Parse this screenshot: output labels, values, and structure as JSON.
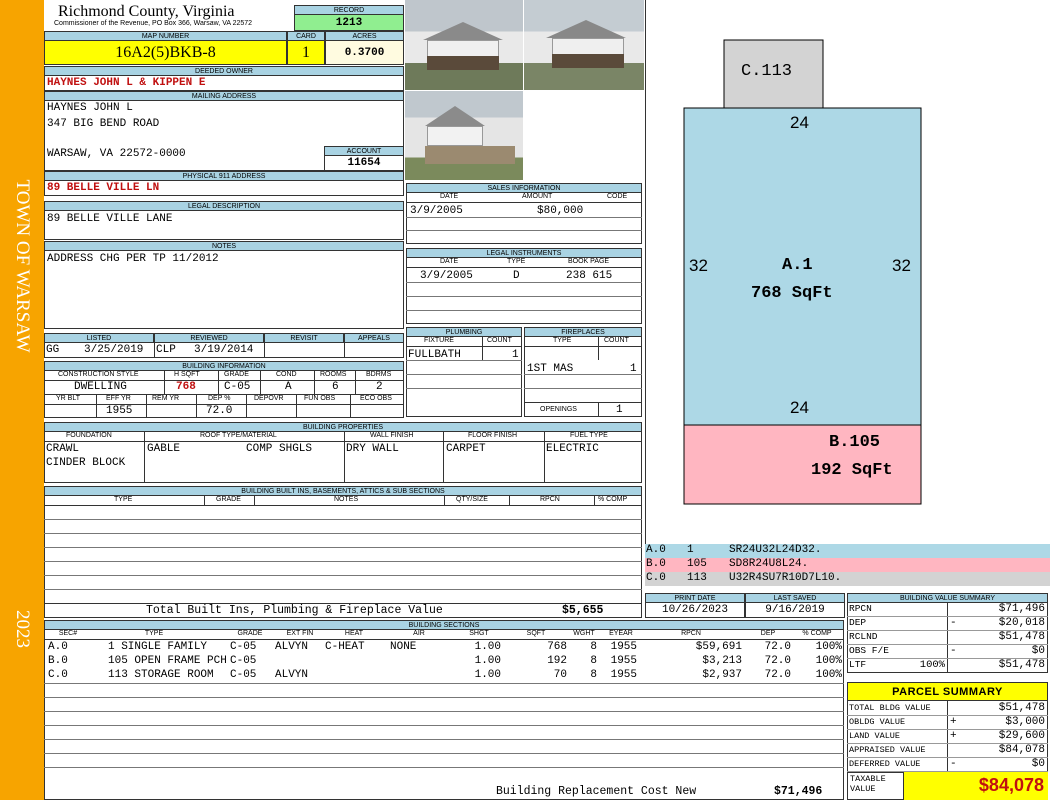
{
  "sidebar": {
    "town": "TOWN OF WARSAW",
    "year": "2023"
  },
  "header": {
    "county": "Richmond County, Virginia",
    "commissioner": "Commissioner of the Revenue, PO Box 366, Warsaw, VA 22572",
    "record_label": "RECORD",
    "record": "1213",
    "map_number_label": "MAP NUMBER",
    "map_number": "16A2(5)BKB-8",
    "card_label": "CARD",
    "card": "1",
    "acres_label": "ACRES",
    "acres": "0.3700"
  },
  "owner": {
    "deeded_owner_label": "DEEDED OWNER",
    "deeded_owner": "HAYNES JOHN L & KIPPEN E",
    "mailing_label": "MAILING ADDRESS",
    "mailing_line1": "HAYNES JOHN L",
    "mailing_line2": "347 BIG BEND ROAD",
    "mailing_line3": "WARSAW, VA 22572-0000",
    "account_label": "ACCOUNT",
    "account": "11654",
    "physical_label": "PHYSICAL 911 ADDRESS",
    "physical": "89 BELLE VILLE LN",
    "legal_label": "LEGAL DESCRIPTION",
    "legal": "89 BELLE VILLE LANE",
    "notes_label": "NOTES",
    "notes": "ADDRESS CHG PER TP 11/2012"
  },
  "listing": {
    "listed_label": "LISTED",
    "listed_by": "GG",
    "listed_date": "3/25/2019",
    "reviewed_label": "REVIEWED",
    "reviewed_by": "CLP",
    "reviewed_date": "3/19/2014",
    "revisit_label": "REVISIT",
    "appeals_label": "APPEALS"
  },
  "building_info": {
    "title": "BUILDING INFORMATION",
    "headers": [
      "CONSTRUCTION STYLE",
      "H SQFT",
      "GRADE",
      "COND",
      "ROOMS",
      "BDRMS"
    ],
    "values": [
      "DWELLING",
      "768",
      "C-05",
      "A",
      "6",
      "2"
    ],
    "headers2": [
      "YR BLT",
      "EFF YR",
      "REM YR",
      "DEP %",
      "DEPOVR",
      "FUN OBS",
      "ECO OBS"
    ],
    "values2": [
      "",
      "1955",
      "",
      "72.0",
      "",
      "",
      ""
    ]
  },
  "sales": {
    "title": "SALES INFORMATION",
    "headers": [
      "DATE",
      "AMOUNT",
      "CODE"
    ],
    "rows": [
      [
        "3/9/2005",
        "$80,000",
        ""
      ]
    ]
  },
  "legal_instruments": {
    "title": "LEGAL INSTRUMENTS",
    "headers": [
      "DATE",
      "TYPE",
      "BOOK PAGE"
    ],
    "rows": [
      [
        "3/9/2005",
        "D",
        "238 615"
      ]
    ]
  },
  "plumbing": {
    "title": "PLUMBING",
    "headers": [
      "FIXTURE",
      "COUNT"
    ],
    "rows": [
      [
        "FULLBATH",
        "1"
      ]
    ]
  },
  "fireplaces": {
    "title": "FIREPLACES",
    "headers": [
      "TYPE",
      "COUNT"
    ],
    "rows": [
      [
        "1ST MAS",
        "1"
      ]
    ],
    "openings_label": "OPENINGS",
    "openings": "1"
  },
  "building_properties": {
    "title": "BUILDING PROPERTIES",
    "headers": [
      "FOUNDATION",
      "ROOF TYPE/MATERIAL",
      "WALL FINISH",
      "FLOOR FINISH",
      "FUEL TYPE"
    ],
    "foundation": [
      "CRAWL",
      "CINDER BLOCK"
    ],
    "roof_type": "GABLE",
    "roof_material": "COMP SHGLS",
    "wall": "DRY WALL",
    "floor": "CARPET",
    "fuel": "ELECTRIC"
  },
  "built_ins": {
    "title": "BUILDING BUILT INS, BASEMENTS, ATTICS & SUB SECTIONS",
    "headers": [
      "TYPE",
      "GRADE",
      "NOTES",
      "QTY/SIZE",
      "RPCN",
      "% COMP"
    ],
    "total_label": "Total Built Ins, Plumbing & Fireplace Value",
    "total": "$5,655"
  },
  "sketch": {
    "c_label": "C.113",
    "a_label": "A.1",
    "a_area": "768 SqFt",
    "a_top": "24",
    "a_bottom": "24",
    "a_left": "32",
    "a_right": "32",
    "b_label": "B.105",
    "b_area": "192 SqFt",
    "colors": {
      "a": "#add8e6",
      "b": "#ffb6c1",
      "c": "#d3d3d3"
    }
  },
  "sketch_codes": [
    {
      "sec": "A.0",
      "num": "1",
      "code": "SR24U32L24D32."
    },
    {
      "sec": "B.0",
      "num": "105",
      "code": "SD8R24U8L24."
    },
    {
      "sec": "C.0",
      "num": "113",
      "code": "U32R4SU7R10D7L10."
    }
  ],
  "dates": {
    "print_label": "PRINT DATE",
    "print": "10/26/2023",
    "saved_label": "LAST SAVED",
    "saved": "9/16/2019"
  },
  "building_sections": {
    "title": "BUILDING SECTIONS",
    "headers": [
      "SEC#",
      "TYPE",
      "GRADE",
      "EXT FIN",
      "HEAT",
      "AIR",
      "SHGT",
      "SQFT",
      "WGHT",
      "EYEAR",
      "RPCN",
      "DEP",
      "% COMP"
    ],
    "rows": [
      [
        "A.0",
        "1 SINGLE FAMILY",
        "C-05",
        "ALVYN",
        "C-HEAT",
        "NONE",
        "1.00",
        "768",
        "8",
        "1955",
        "$59,691",
        "72.0",
        "100%"
      ],
      [
        "B.0",
        "105 OPEN FRAME PCH",
        "C-05",
        "",
        "",
        "",
        "1.00",
        "192",
        "8",
        "1955",
        "$3,213",
        "72.0",
        "100%"
      ],
      [
        "C.0",
        "113 STORAGE ROOM",
        "C-05",
        "ALVYN",
        "",
        "",
        "1.00",
        "70",
        "8",
        "1955",
        "$2,937",
        "72.0",
        "100%"
      ]
    ],
    "replacement_label": "Building Replacement Cost New",
    "replacement": "$71,496"
  },
  "value_summary": {
    "title": "BUILDING VALUE SUMMARY",
    "rows": [
      {
        "label": "RPCN",
        "mid": "",
        "sign": "",
        "value": "$71,496"
      },
      {
        "label": "DEP",
        "mid": "",
        "sign": "-",
        "value": "$20,018"
      },
      {
        "label": "RCLND",
        "mid": "",
        "sign": "",
        "value": "$51,478"
      },
      {
        "label": "OBS F/E",
        "mid": "",
        "sign": "-",
        "value": "$0"
      },
      {
        "label": "LTF",
        "mid": "100%",
        "sign": "",
        "value": "$51,478"
      }
    ]
  },
  "parcel_summary": {
    "title": "PARCEL SUMMARY",
    "rows": [
      {
        "label": "TOTAL BLDG VALUE",
        "sign": "",
        "value": "$51,478"
      },
      {
        "label": "OBLDG VALUE",
        "sign": "+",
        "value": "$3,000"
      },
      {
        "label": "LAND VALUE",
        "sign": "+",
        "value": "$29,600"
      },
      {
        "label": "APPRAISED VALUE",
        "sign": "",
        "value": "$84,078"
      },
      {
        "label": "DEFERRED VALUE",
        "sign": "-",
        "value": "$0"
      }
    ],
    "taxable_label": "TAXABLE VALUE",
    "taxable": "$84,078"
  }
}
